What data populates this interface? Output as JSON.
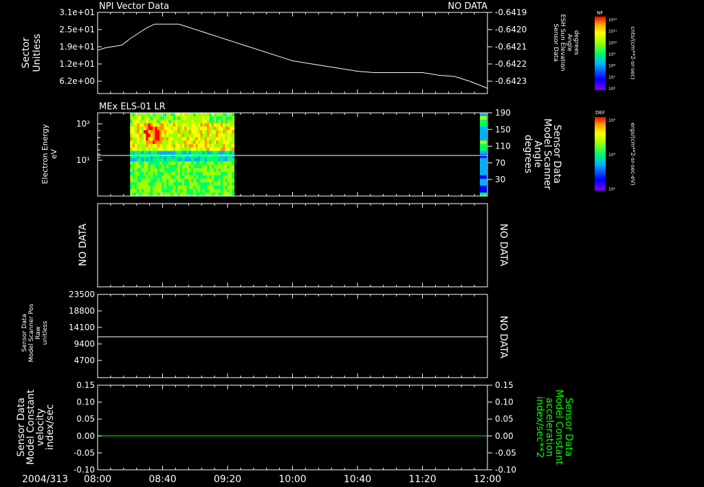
{
  "colors": {
    "background": "#000000",
    "foreground": "#ffffff",
    "accent_green": "#00ff00",
    "colorbar": [
      "#7f00ff",
      "#0000ff",
      "#00b0ff",
      "#00ff66",
      "#a0ff00",
      "#ffff00",
      "#ff9900",
      "#ff0000"
    ]
  },
  "chart_data": {
    "time_axis": {
      "date": "2004/313",
      "ticks": [
        "08:00",
        "08:40",
        "09:20",
        "10:00",
        "10:40",
        "11:20",
        "12:00"
      ],
      "range": [
        "08:00",
        "12:00"
      ]
    },
    "panels": [
      {
        "id": "sector",
        "type": "line",
        "title_left": "NPI Vector Data",
        "title_right": "NO DATA",
        "ylabel": [
          "Sector",
          "Unitless"
        ],
        "yticks": [
          "3.1e+01",
          "2.5e+01",
          "1.9e+01",
          "1.2e+01",
          "6.2e+00"
        ],
        "ylim": [
          0,
          31
        ],
        "right_ylabel": [
          "Sensor Data",
          "ESH Sun Elevation",
          "Angle",
          "degrees"
        ],
        "right_yticks": [
          "-0.6419",
          "-0.6420",
          "-0.6421",
          "-0.6422",
          "-0.6423"
        ],
        "series": [
          {
            "x": [
              "08:00",
              "08:05",
              "08:10",
              "08:15",
              "08:20",
              "08:25",
              "08:30",
              "08:35",
              "08:40",
              "08:45",
              "08:50",
              "08:55",
              "09:00",
              "09:05",
              "09:10",
              "09:15",
              "09:20",
              "09:25",
              "09:30",
              "09:40",
              "09:50",
              "10:00",
              "10:10",
              "10:20",
              "10:30",
              "10:40",
              "10:50",
              "11:00",
              "11:10",
              "11:20",
              "11:30",
              "11:40",
              "11:50",
              "12:00"
            ],
            "y": [
              16.5,
              17.5,
              18.0,
              18.5,
              21.0,
              23.0,
              25.0,
              26.5,
              26.5,
              26.5,
              26.5,
              25.5,
              24.5,
              23.5,
              22.5,
              21.5,
              20.5,
              19.5,
              18.5,
              16.5,
              14.5,
              12.5,
              11.5,
              10.5,
              9.5,
              8.5,
              8.0,
              8.0,
              8.0,
              8.0,
              7.0,
              6.5,
              4.5,
              2.0
            ]
          }
        ]
      },
      {
        "id": "els",
        "type": "heatmap",
        "title_left": "MEx ELS-01 LR",
        "ylabel": [
          "Electron Energy",
          "eV"
        ],
        "yticks": [
          "10²",
          "10¹"
        ],
        "yscale": "log",
        "right_ylabel": [
          "Sensor Data",
          "Model Scanner",
          "Angle",
          "degrees"
        ],
        "right_yticks": [
          "190",
          "150",
          "110",
          "70",
          "30"
        ],
        "ylim": [
          0,
          190
        ],
        "data_window": [
          "08:20",
          "09:24"
        ],
        "scanner_angle": 90
      },
      {
        "id": "empty",
        "type": "line",
        "ylabel": [
          "NO DATA"
        ],
        "right_ylabel": [
          "NO DATA"
        ]
      },
      {
        "id": "scanner_pos",
        "type": "line",
        "ylabel": [
          "Sensor Data",
          "Model Scanner Pos",
          "Raw",
          "unitless"
        ],
        "yticks": [
          "23500",
          "18800",
          "14100",
          "9400",
          "4700"
        ],
        "ylim": [
          0,
          23500
        ],
        "right_ylabel": [
          "NO DATA"
        ],
        "series": [
          {
            "x": [
              "08:00",
              "12:00"
            ],
            "y": [
              11500,
              11500
            ]
          }
        ]
      },
      {
        "id": "velocity",
        "type": "line",
        "ylabel": [
          "Sensor Data",
          "Model Constant",
          "velocity",
          "index/sec"
        ],
        "yticks": [
          "0.15",
          "0.10",
          "0.05",
          "0.00",
          "-0.05",
          "-0.10"
        ],
        "ylim": [
          -0.1,
          0.15
        ],
        "right_ylabel": [
          "Sensor Data",
          "Model Constant",
          "acceleration",
          "index/sec**2"
        ],
        "right_yticks": [
          "0.15",
          "0.10",
          "0.05",
          "0.00",
          "-0.05",
          "-0.10"
        ],
        "series": [
          {
            "x": [
              "08:00",
              "12:00"
            ],
            "y": [
              0.0,
              0.0
            ]
          }
        ]
      }
    ],
    "colorbars": [
      {
        "label": "NF",
        "units": "cnts/(cm**2-sr-sec)",
        "ticks": [
          "10¹²",
          "10¹¹",
          "10¹⁰",
          "10⁹",
          "10⁸",
          "10⁷",
          "10⁶"
        ]
      },
      {
        "label": "DEF",
        "units": "ergs/(cm**2-sr-sec-eV)",
        "ticks": [
          "10⁴",
          "10³",
          "10¹"
        ]
      }
    ]
  }
}
